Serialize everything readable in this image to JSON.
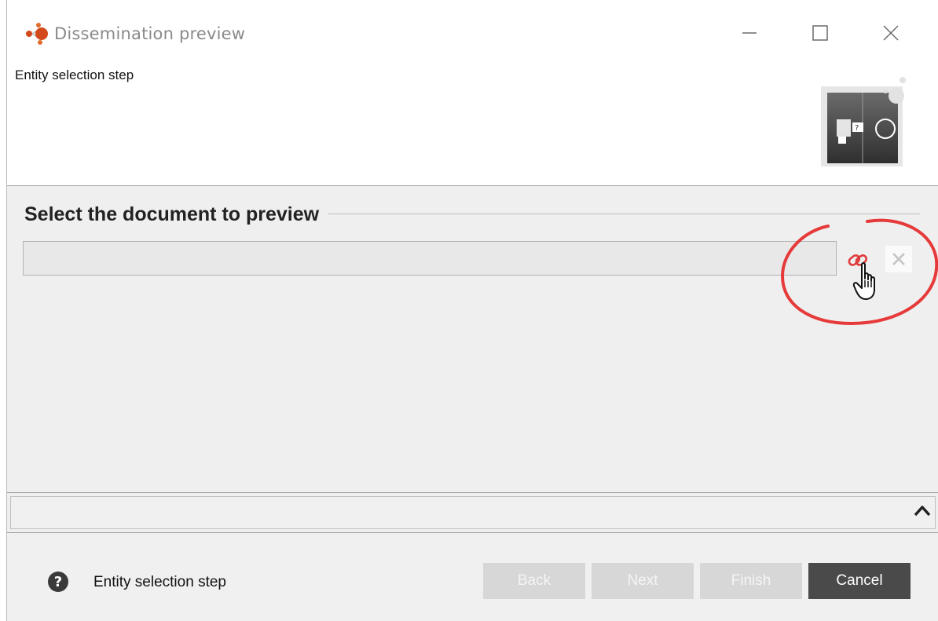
{
  "window": {
    "title": "Dissemination preview"
  },
  "header": {
    "subtitle": "Entity selection step"
  },
  "group": {
    "title": "Select the document to preview"
  },
  "document_field": {
    "value": ""
  },
  "footer": {
    "message": "Entity selection step",
    "buttons": {
      "back": "Back",
      "next": "Next",
      "finish": "Finish",
      "cancel": "Cancel"
    }
  },
  "icons": {
    "app": "app-molecule-icon",
    "link": "link-icon",
    "clear": "close-icon",
    "cursor": "hand-cursor-icon",
    "collapse": "chevron-up-icon",
    "help": "help-icon"
  },
  "colors": {
    "highlight_ring": "#e63a3a",
    "link_icon": "#e03b3b",
    "cancel_button": "#4a4a4a",
    "disabled_button": "#d7d7d7",
    "app_icon_primary": "#d24a1c"
  }
}
